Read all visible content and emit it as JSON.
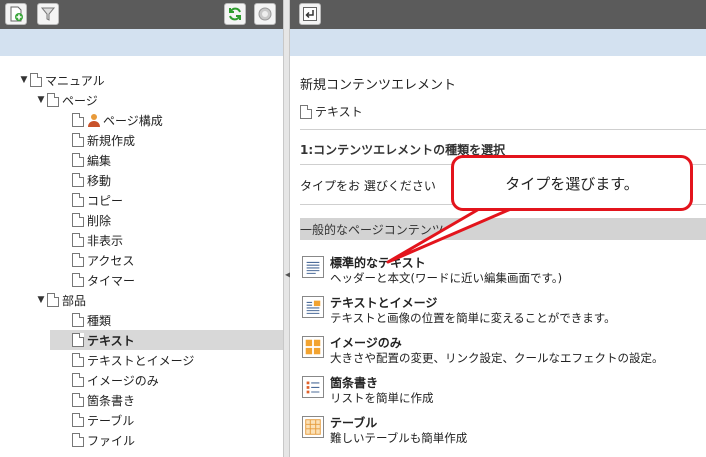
{
  "tree": {
    "items": [
      {
        "label": "マニュアル",
        "toggle": "▼"
      },
      {
        "label": "ページ",
        "toggle": "▼"
      },
      {
        "label": "ページ構成",
        "toggle": ""
      },
      {
        "label": "新規作成",
        "toggle": ""
      },
      {
        "label": "編集",
        "toggle": ""
      },
      {
        "label": "移動",
        "toggle": ""
      },
      {
        "label": "コピー",
        "toggle": ""
      },
      {
        "label": "削除",
        "toggle": ""
      },
      {
        "label": "非表示",
        "toggle": ""
      },
      {
        "label": "アクセス",
        "toggle": ""
      },
      {
        "label": "タイマー",
        "toggle": ""
      },
      {
        "label": "部品",
        "toggle": "▼"
      },
      {
        "label": "種類",
        "toggle": ""
      },
      {
        "label": "テキスト",
        "toggle": ""
      },
      {
        "label": "テキストとイメージ",
        "toggle": ""
      },
      {
        "label": "イメージのみ",
        "toggle": ""
      },
      {
        "label": "箇条書き",
        "toggle": ""
      },
      {
        "label": "テーブル",
        "toggle": ""
      },
      {
        "label": "ファイル",
        "toggle": ""
      }
    ]
  },
  "right": {
    "title": "新規コンテンツエレメント",
    "type_label": "テキスト",
    "step_label": "1:コンテンツエレメントの種類を選択",
    "prompt": "タイプをお 選びください",
    "section_label": "一般的なページコンテンツ",
    "options": [
      {
        "title": "標準的なテキスト",
        "desc": "ヘッダーと本文(ワードに近い編集画面です。)"
      },
      {
        "title": "テキストとイメージ",
        "desc": "テキストと画像の位置を簡単に変えることができます。"
      },
      {
        "title": "イメージのみ",
        "desc": "大きさや配置の変更、リンク設定、クールなエフェクトの設定。"
      },
      {
        "title": "箇条書き",
        "desc": "リストを簡単に作成"
      },
      {
        "title": "テーブル",
        "desc": "難しいテーブルも簡単作成"
      }
    ]
  },
  "callout": {
    "text": "タイプを選びます。"
  },
  "colors": {
    "toolbar": "#5b5b5b",
    "subbar": "#d3e1f0",
    "selected": "#d8d8d8",
    "callout_border": "#e3141c"
  }
}
